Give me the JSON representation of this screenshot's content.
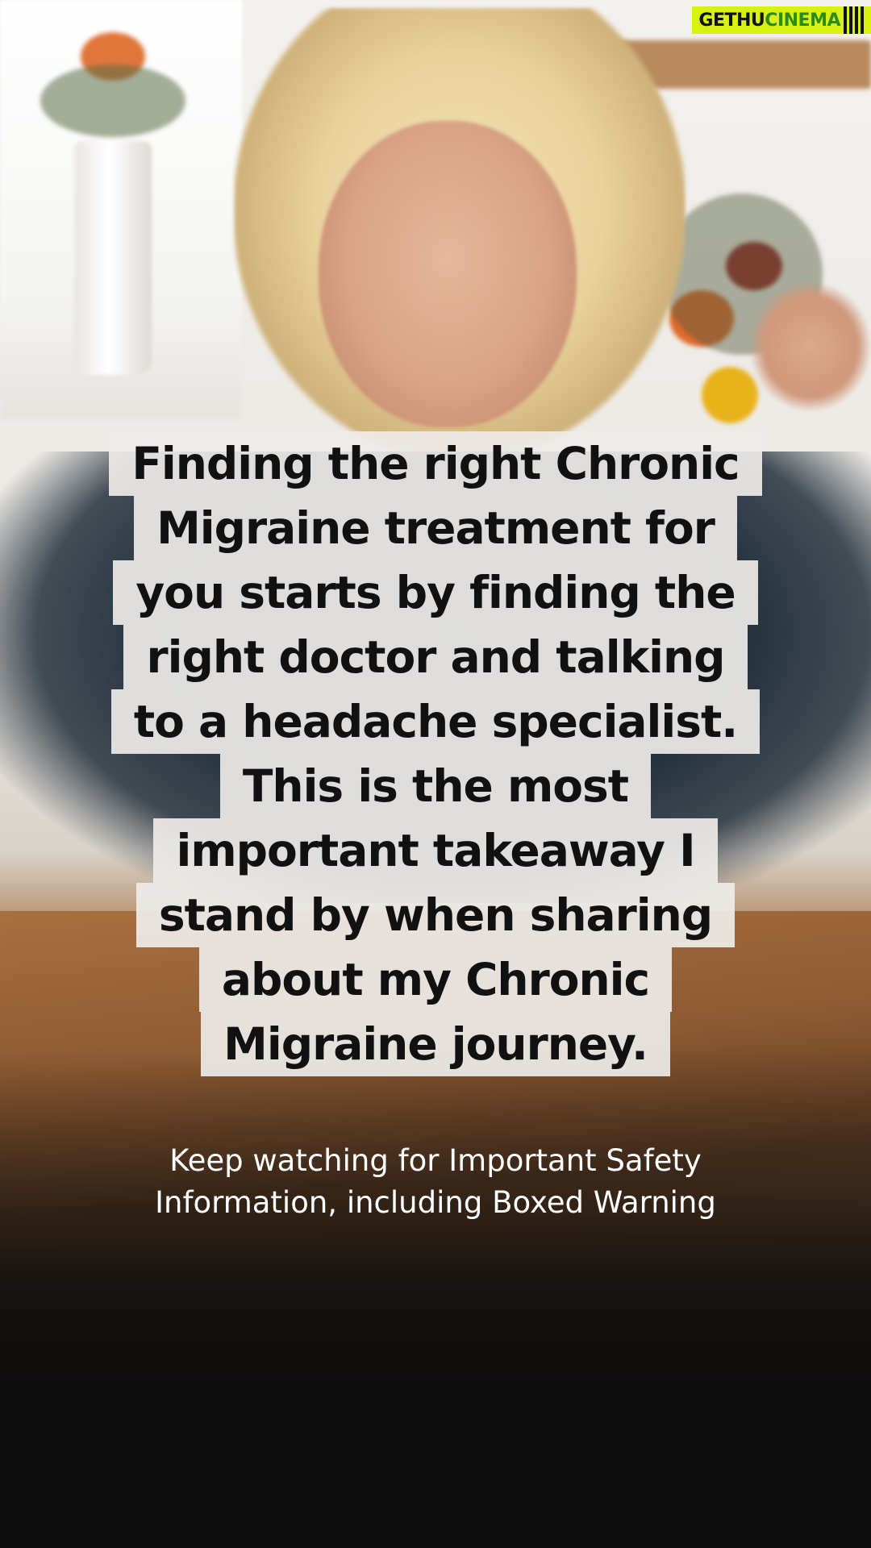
{
  "watermark": {
    "part1": "GETHU",
    "part2": "CINEMA"
  },
  "caption": {
    "lines": [
      "Finding the right Chronic",
      "Migraine treatment for",
      "you starts by finding the",
      "right doctor and talking",
      "to a headache specialist.",
      "This is the most",
      "important takeaway I",
      "stand by when sharing",
      "about my Chronic",
      "Migraine journey."
    ]
  },
  "safety_note": {
    "line1": "Keep watching for Important Safety",
    "line2": "Information, including Boxed Warning"
  },
  "colors": {
    "caption_background": "#eeece9",
    "caption_text": "#111111",
    "watermark_background": "#d7f20f"
  }
}
